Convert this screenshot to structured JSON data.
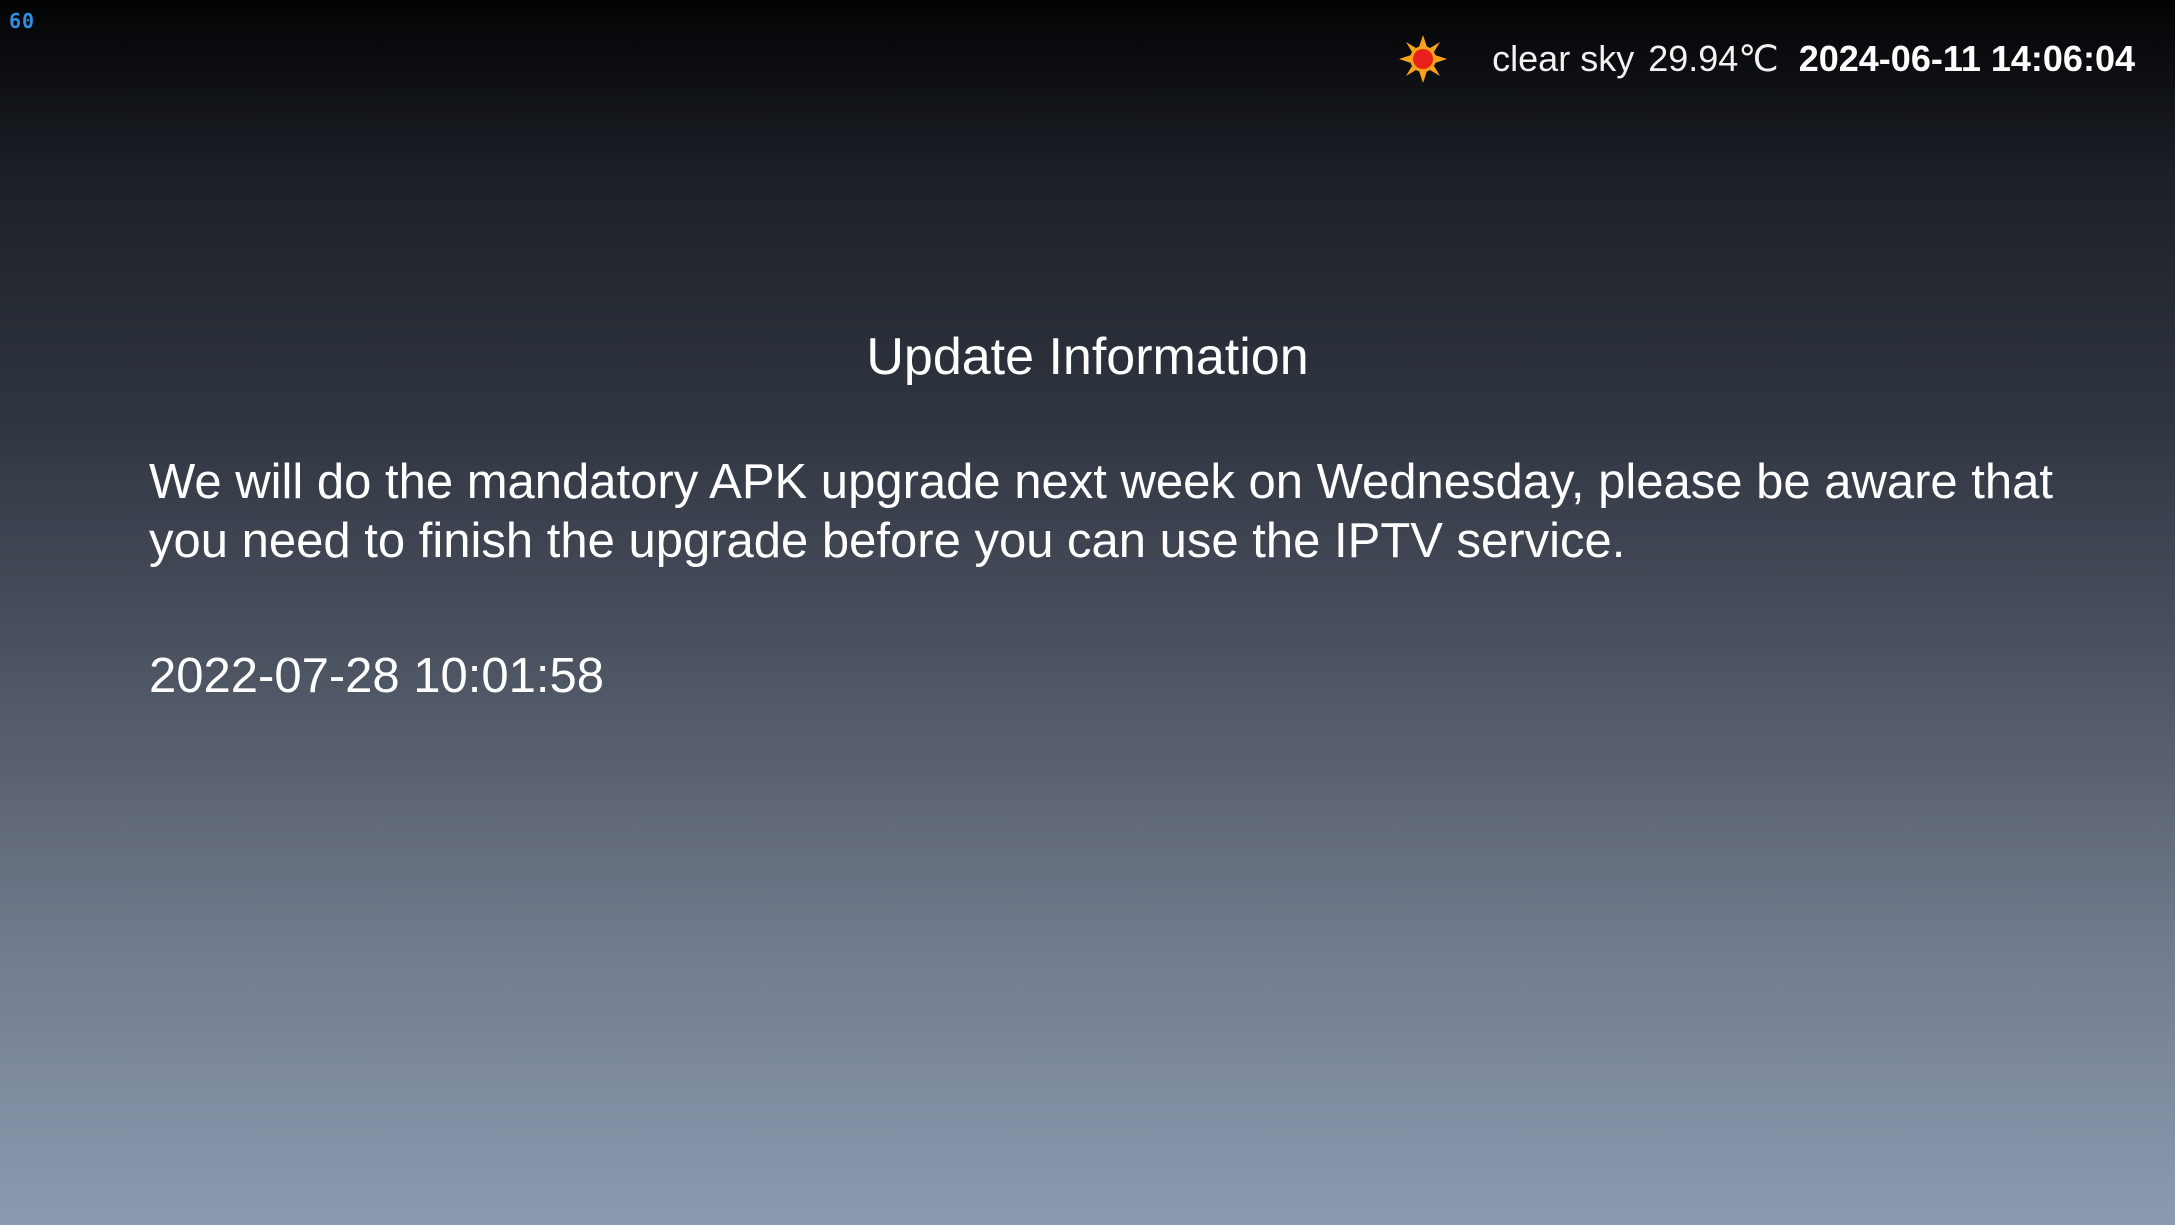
{
  "fps_counter": "60",
  "status": {
    "weather_icon": "sun-icon",
    "weather_description": "clear sky",
    "temperature": "29.94℃",
    "datetime": "2024-06-11 14:06:04"
  },
  "dialog": {
    "title": "Update Information",
    "message": "We will do the mandatory APK upgrade next week on Wednesday, please be aware that you need to finish the upgrade before you can use the IPTV service.",
    "timestamp": "2022-07-28 10:01:58"
  },
  "colors": {
    "fps_text": "#2f8fe0",
    "sun_core": "#e8201a",
    "sun_rays": "#f7a21b",
    "background_top": "#020304",
    "background_bottom": "#8c9ab0"
  }
}
